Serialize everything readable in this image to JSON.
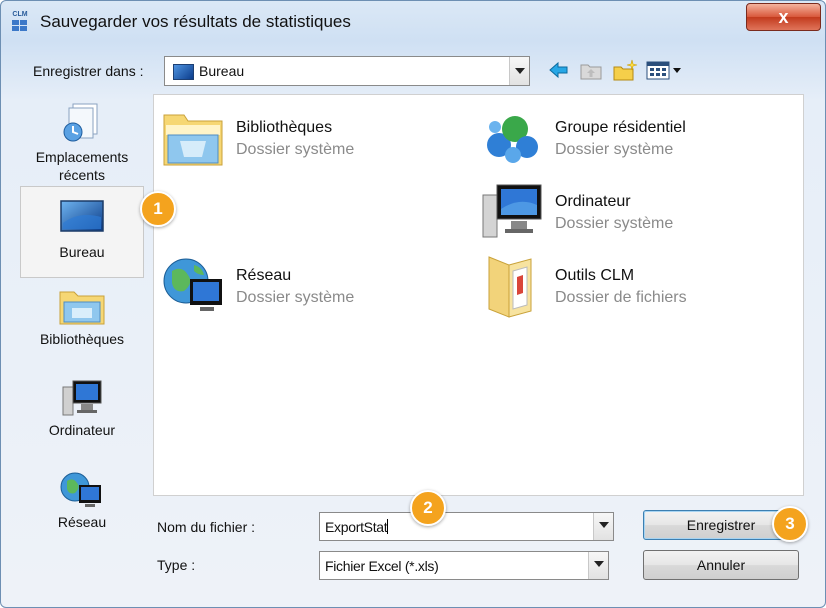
{
  "window": {
    "title": "Sauvegarder vos résultats de statistiques",
    "app_icon_text": "CLM",
    "close_label": "x"
  },
  "toolbar": {
    "save_in_label": "Enregistrer dans :",
    "location_value": "Bureau",
    "icons": [
      "back-arrow-icon",
      "up-folder-icon",
      "new-folder-icon",
      "views-menu-icon"
    ]
  },
  "places": [
    {
      "label": "Emplacements\nrécents",
      "line1": "Emplacements",
      "line2": "récents",
      "icon": "recent-places-icon",
      "selected": false
    },
    {
      "label": "Bureau",
      "icon": "desktop-icon",
      "selected": true
    },
    {
      "label": "Bibliothèques",
      "icon": "libraries-icon",
      "selected": false
    },
    {
      "label": "Ordinateur",
      "icon": "computer-icon",
      "selected": false
    },
    {
      "label": "Réseau",
      "icon": "network-icon",
      "selected": false
    }
  ],
  "files": [
    {
      "name": "Bibliothèques",
      "type": "Dossier système",
      "icon": "libraries-folder-icon"
    },
    {
      "name": "Groupe résidentiel",
      "type": "Dossier système",
      "icon": "homegroup-icon"
    },
    {
      "name": "Ordinateur",
      "type": "Dossier système",
      "icon": "computer-icon"
    },
    {
      "name": "Réseau",
      "type": "Dossier système",
      "icon": "network-globe-icon"
    },
    {
      "name": "Outils CLM",
      "type": "Dossier de fichiers",
      "icon": "folder-icon"
    }
  ],
  "form": {
    "filename_label": "Nom du fichier :",
    "filename_value": "ExportStat",
    "type_label": "Type :",
    "type_value": "Fichier Excel (*.xls)"
  },
  "buttons": {
    "save_label": "Enregistrer",
    "cancel_label": "Annuler"
  },
  "callouts": [
    "1",
    "2",
    "3"
  ],
  "colors": {
    "callout": "#f4a31e",
    "close_button": "#d8573a",
    "subtext": "#8a8a8a"
  }
}
